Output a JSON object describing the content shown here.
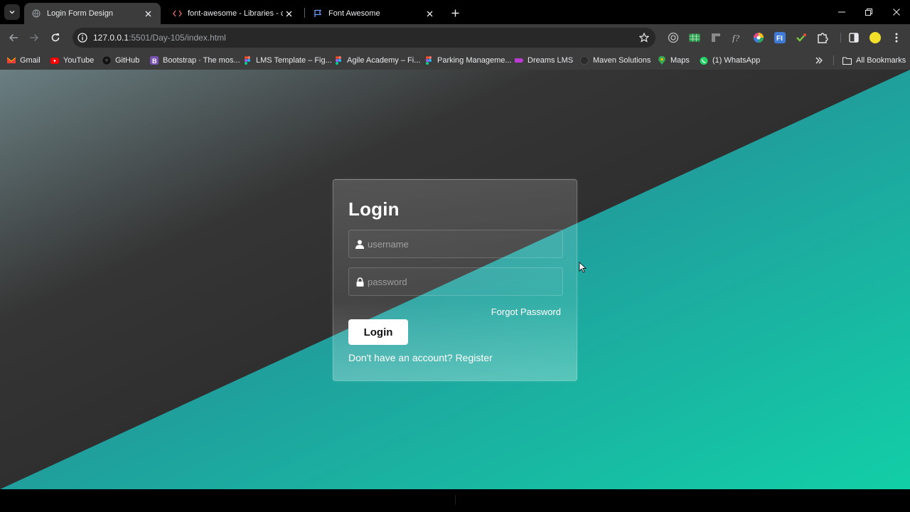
{
  "browser": {
    "tabs": [
      {
        "title": "Login Form Design",
        "active": true,
        "icon": "globe-icon"
      },
      {
        "title": "font-awesome - Libraries - cdnj",
        "active": false,
        "icon": "code-icon"
      },
      {
        "title": "Font Awesome",
        "active": false,
        "icon": "flag-icon"
      }
    ],
    "url_host": "127.0.0.1",
    "url_rest": ":5501/Day-105/index.html",
    "bookmarks": [
      {
        "label": "Gmail",
        "icon": "gmail-icon"
      },
      {
        "label": "YouTube",
        "icon": "youtube-icon"
      },
      {
        "label": "GitHub",
        "icon": "github-icon"
      },
      {
        "label": "Bootstrap · The mos...",
        "icon": "bootstrap-icon"
      },
      {
        "label": "LMS Template – Fig...",
        "icon": "figma-icon"
      },
      {
        "label": "Agile Academy – Fi...",
        "icon": "figma-icon"
      },
      {
        "label": "Parking Manageme...",
        "icon": "figma-icon"
      },
      {
        "label": "Dreams LMS",
        "icon": "dreams-icon"
      },
      {
        "label": "Maven Solutions",
        "icon": "globe-icon"
      },
      {
        "label": "Maps",
        "icon": "maps-icon"
      },
      {
        "label": "(1) WhatsApp",
        "icon": "whatsapp-icon"
      }
    ],
    "all_bookmarks": "All Bookmarks"
  },
  "login": {
    "title": "Login",
    "username_placeholder": "username",
    "password_placeholder": "password",
    "forgot": "Forgot Password",
    "button": "Login",
    "register_prompt": "Don't have an account?",
    "register_link": "Register"
  },
  "colors": {
    "bg_dark": "#2a2a2a",
    "bg_teal": "#14c9a6",
    "accent_teal": "#239b9e"
  }
}
